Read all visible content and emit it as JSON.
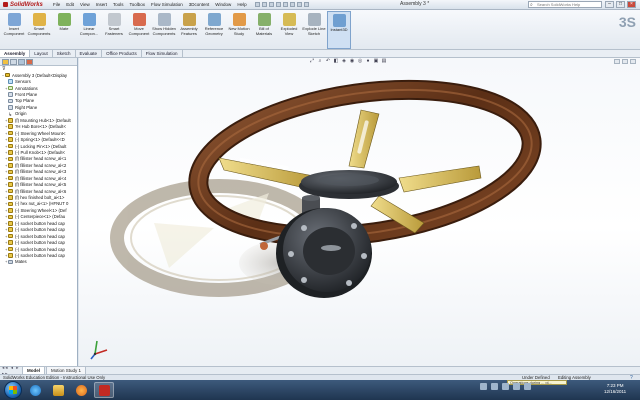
{
  "window": {
    "app_name": "SolidWorks",
    "document_title": "Assembly 3 *",
    "search_placeholder": "Search SolidWorks Help",
    "minimize": "–",
    "maximize": "□",
    "close": "×"
  },
  "menus": [
    "File",
    "Edit",
    "View",
    "Insert",
    "Tools",
    "Toolbox",
    "Flow Simulation",
    "3Dcontent",
    "Window",
    "Help"
  ],
  "ribbon": [
    {
      "label": "Insert Component",
      "color": "#7ea6d6"
    },
    {
      "label": "Smart Components",
      "color": "#e0b347"
    },
    {
      "label": "Mate",
      "color": "#7fb25c"
    },
    {
      "label": "Linear Compon...",
      "color": "#6fa2d8"
    },
    {
      "label": "Smart Fasteners",
      "color": "#c2c8cf"
    },
    {
      "label": "Move Component",
      "color": "#d86a4e"
    },
    {
      "label": "Show Hidden Components",
      "color": "#aab8c8"
    },
    {
      "label": "Assembly Features",
      "color": "#c9a24b"
    },
    {
      "label": "Reference Geometry",
      "color": "#7fa8cf"
    },
    {
      "label": "New Motion Study",
      "color": "#e29a48"
    },
    {
      "label": "Bill of Materials",
      "color": "#86b06a"
    },
    {
      "label": "Exploded View",
      "color": "#d6bb55"
    },
    {
      "label": "Explode Line Sketch",
      "color": "#a7b3bf"
    },
    {
      "label": "Instant3D",
      "color": "#6f9fd1"
    }
  ],
  "command_tabs": [
    "Assembly",
    "Layout",
    "Sketch",
    "Evaluate",
    "Office Products",
    "Flow Simulation"
  ],
  "feature_tree": [
    {
      "label": "Assembly 3  (Default<Display",
      "icon": "asm",
      "level": 0,
      "toggle": "−"
    },
    {
      "label": "Sensors",
      "icon": "sen",
      "level": 1,
      "toggle": ""
    },
    {
      "label": "Annotations",
      "icon": "ann",
      "level": 1,
      "toggle": "+"
    },
    {
      "label": "Front Plane",
      "icon": "pln",
      "level": 1,
      "toggle": ""
    },
    {
      "label": "Top Plane",
      "icon": "pln",
      "level": 1,
      "toggle": ""
    },
    {
      "label": "Right Plane",
      "icon": "pln",
      "level": 1,
      "toggle": ""
    },
    {
      "label": "Origin",
      "icon": "org",
      "level": 1,
      "toggle": ""
    },
    {
      "label": "(f) Mounting Hub<1> (Default",
      "icon": "prt",
      "level": 1,
      "toggle": "+"
    },
    {
      "label": "?H Hub Bore<1> (Default<",
      "icon": "prt",
      "level": 1,
      "toggle": "+"
    },
    {
      "label": "(-) Steering Wheel Mount<",
      "icon": "prt",
      "level": 1,
      "toggle": "+"
    },
    {
      "label": "(-) Spring<1> (Default<<D",
      "icon": "prt",
      "level": 1,
      "toggle": "+"
    },
    {
      "label": "(-) Locking Pin<1> (Default",
      "icon": "prt",
      "level": 1,
      "toggle": "+"
    },
    {
      "label": "(-) Pull Knob<1> (Default<",
      "icon": "prt",
      "level": 1,
      "toggle": "+"
    },
    {
      "label": "(f) fillister head screw_al<1",
      "icon": "prt",
      "level": 1,
      "toggle": "+"
    },
    {
      "label": "(f) fillister head screw_al<2",
      "icon": "prt",
      "level": 1,
      "toggle": "+"
    },
    {
      "label": "(f) fillister head screw_al<3",
      "icon": "prt",
      "level": 1,
      "toggle": "+"
    },
    {
      "label": "(f) fillister head screw_al<4",
      "icon": "prt",
      "level": 1,
      "toggle": "+"
    },
    {
      "label": "(f) fillister head screw_al<5",
      "icon": "prt",
      "level": 1,
      "toggle": "+"
    },
    {
      "label": "(f) fillister head screw_al<6",
      "icon": "prt",
      "level": 1,
      "toggle": "+"
    },
    {
      "label": "(f) hex finished bolt_ai<1>",
      "icon": "prt",
      "level": 1,
      "toggle": "+"
    },
    {
      "label": "(-) hex nut_ai<1> (HFNUT 0",
      "icon": "prt",
      "level": 1,
      "toggle": "+"
    },
    {
      "label": "(-) Steering Wheel<1> (Def",
      "icon": "prt",
      "level": 1,
      "toggle": "+"
    },
    {
      "label": "(-) Centerpiece<1> (Defau",
      "icon": "prt",
      "level": 1,
      "toggle": "+"
    },
    {
      "label": "(-) socket button head cap",
      "icon": "prt",
      "level": 1,
      "toggle": "+"
    },
    {
      "label": "(-) socket button head cap",
      "icon": "prt",
      "level": 1,
      "toggle": "+"
    },
    {
      "label": "(-) socket button head cap",
      "icon": "prt",
      "level": 1,
      "toggle": "+"
    },
    {
      "label": "(-) socket button head cap",
      "icon": "prt",
      "level": 1,
      "toggle": "+"
    },
    {
      "label": "(-) socket button head cap",
      "icon": "prt",
      "level": 1,
      "toggle": "+"
    },
    {
      "label": "(-) socket button head cap",
      "icon": "prt",
      "level": 1,
      "toggle": "+"
    },
    {
      "label": "Mates",
      "icon": "mat",
      "level": 1,
      "toggle": "+"
    }
  ],
  "model_tabs": [
    "Model",
    "Motion Study 1"
  ],
  "model_tabs_nav": "◂◂ ◂ ▸ ▸▸",
  "status": {
    "left": "SolidWorks Education Edition - Instructional Use Only",
    "definition": "Under Defined",
    "mode": "Editing Assembly",
    "help": "?"
  },
  "taskbar": {
    "time": "7:23 PM",
    "date": "12/16/2011",
    "notification": "Operations during ... pl..."
  },
  "colors": {
    "wood": "#6b3a1f",
    "brass": "#d9c36a",
    "hub": "#3a3d42",
    "accent": "#b31b1b"
  }
}
